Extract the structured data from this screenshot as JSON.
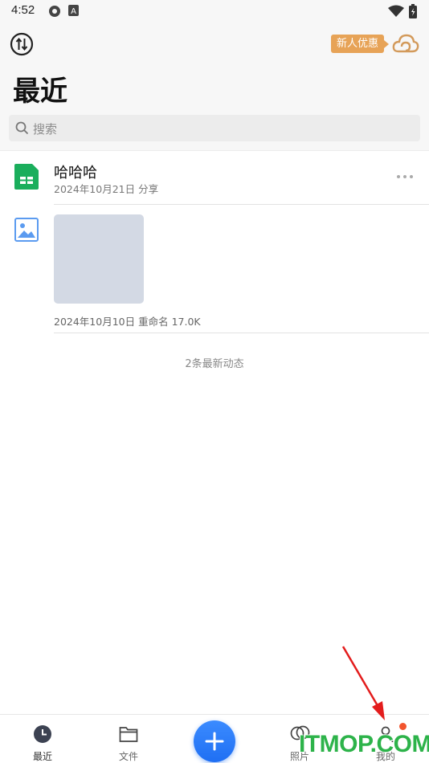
{
  "status_bar": {
    "time": "4:52"
  },
  "header": {
    "title": "最近",
    "promo_badge": "新人优惠",
    "search": {
      "placeholder": "搜索"
    }
  },
  "recent": [
    {
      "title": "哈哈哈",
      "meta": "2024年10月21日  分享",
      "icon": "spreadsheet-icon"
    },
    {
      "meta": "2024年10月10日  重命名  17.0K",
      "icon": "image-icon"
    }
  ],
  "update_note": "2条最新动态",
  "bottom_nav": {
    "items": [
      {
        "label": "最近",
        "icon": "clock-icon"
      },
      {
        "label": "文件",
        "icon": "folder-icon"
      },
      {
        "label": "照片",
        "icon": "photos-icon"
      },
      {
        "label": "我的",
        "icon": "person-icon"
      }
    ],
    "fab_icon": "plus-icon"
  },
  "watermark": "ITMOP.COM",
  "colors": {
    "accent": "#1f6ff3",
    "promo": "#e7a357",
    "sheet_green": "#1aae5c",
    "notify": "#f2542d"
  }
}
